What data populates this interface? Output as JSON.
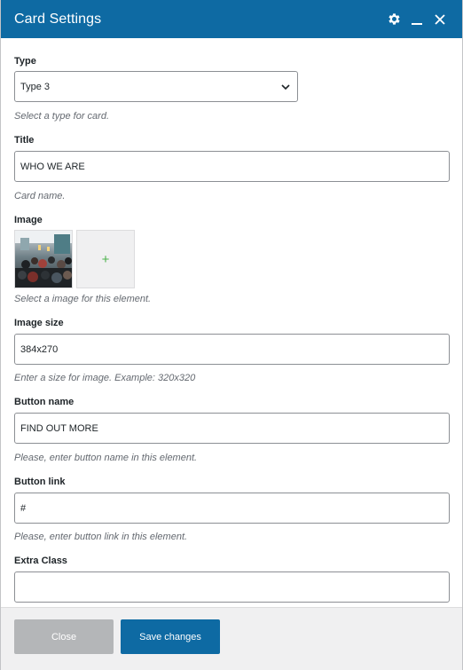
{
  "header": {
    "title": "Card Settings",
    "icons": [
      "gear-icon",
      "minimize-icon",
      "close-icon"
    ]
  },
  "form": {
    "type": {
      "label": "Type",
      "value": "Type 3",
      "help": "Select a type for card."
    },
    "title": {
      "label": "Title",
      "value": "WHO WE ARE",
      "help": "Card name."
    },
    "image": {
      "label": "Image",
      "add_symbol": "+",
      "help": "Select a image for this element."
    },
    "image_size": {
      "label": "Image size",
      "value": "384x270",
      "help": "Enter a size for image. Example: 320x320"
    },
    "button_name": {
      "label": "Button name",
      "value": "FIND OUT MORE",
      "help": "Please, enter button name in this element."
    },
    "button_link": {
      "label": "Button link",
      "value": "#",
      "help": "Please, enter button link in this element."
    },
    "extra_class": {
      "label": "Extra Class",
      "value": ""
    }
  },
  "footer": {
    "close_label": "Close",
    "save_label": "Save changes"
  },
  "colors": {
    "header": "#0e6aa3",
    "primary_button": "#0e6aa3",
    "disabled_button": "#b4b6b8",
    "add_plus": "#4cb24c"
  }
}
